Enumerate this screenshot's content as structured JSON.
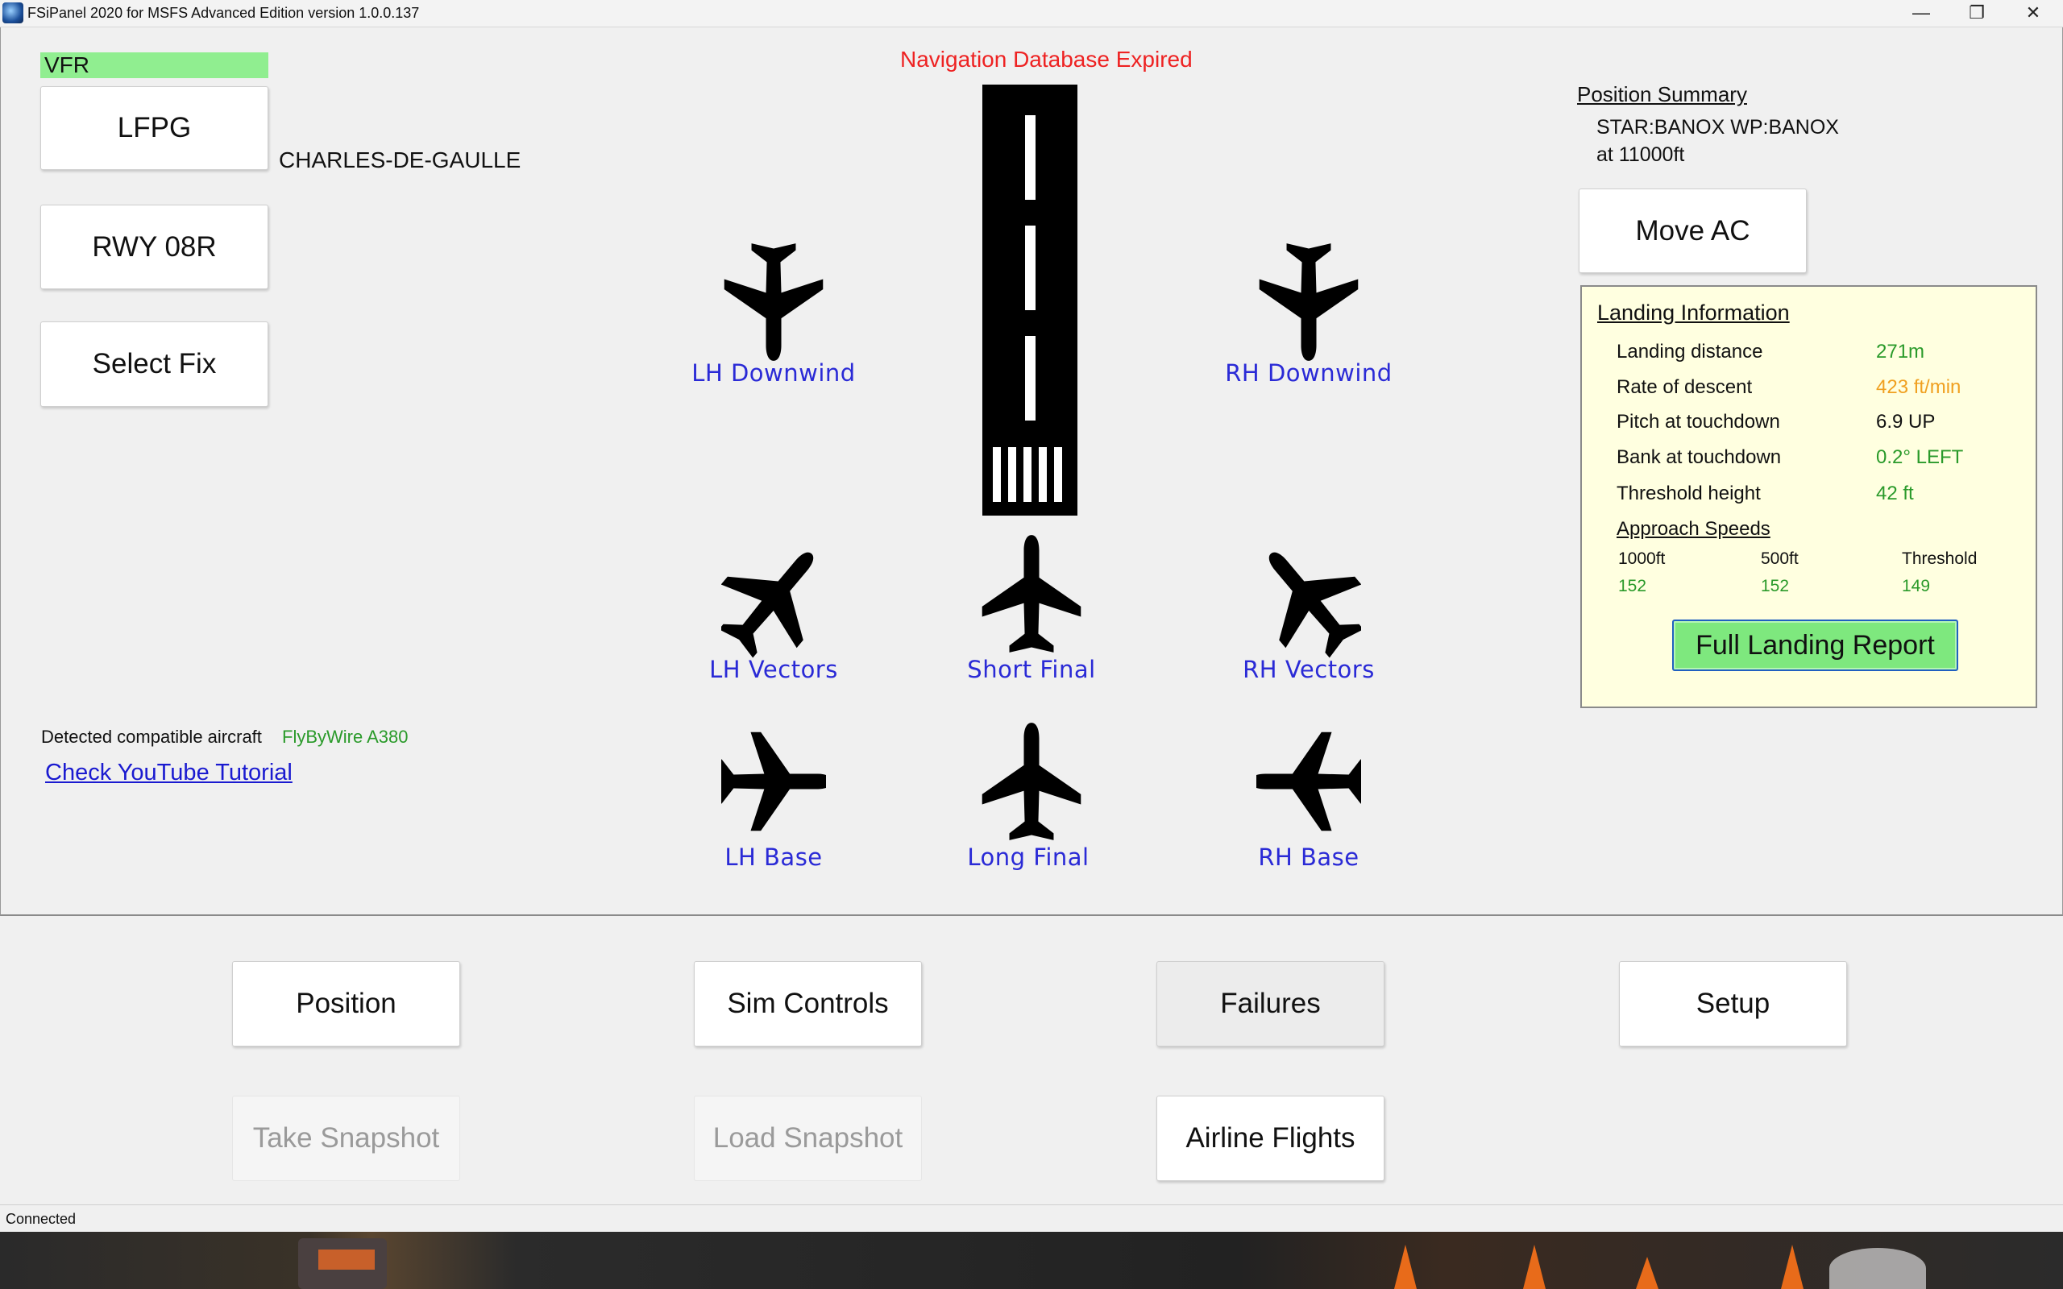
{
  "window": {
    "title": "FSiPanel 2020 for MSFS Advanced Edition version 1.0.0.137",
    "minimize_icon": "minimize-icon",
    "restore_icon": "restore-icon",
    "close_icon": "close-icon"
  },
  "flight_rules": "VFR",
  "airport": {
    "icao_button": "LFPG",
    "name": "CHARLES-DE-GAULLE",
    "runway_button": "RWY 08R",
    "select_fix_button": "Select Fix"
  },
  "nav_warning": "Navigation Database Expired",
  "patterns": {
    "lh_downwind": "LH Downwind",
    "rh_downwind": "RH Downwind",
    "lh_vectors": "LH Vectors",
    "short_final": "Short Final",
    "rh_vectors": "RH Vectors",
    "lh_base": "LH Base",
    "long_final": "Long Final",
    "rh_base": "RH Base"
  },
  "aircraft": {
    "label": "Detected compatible aircraft",
    "value": "FlyByWire A380",
    "tutorial_link": "Check YouTube Tutorial"
  },
  "position_summary": {
    "title": "Position Summary",
    "line1": "STAR:BANOX WP:BANOX",
    "line2": "at 11000ft",
    "move_button": "Move AC"
  },
  "landing_info": {
    "title": "Landing Information",
    "rows": [
      {
        "label": "Landing distance",
        "value": "271m",
        "color": "#2a9a2a"
      },
      {
        "label": "Rate of descent",
        "value": "423 ft/min",
        "color": "#f0a020"
      },
      {
        "label": "Pitch at touchdown",
        "value": "6.9 UP",
        "color": "#111111"
      },
      {
        "label": "Bank at touchdown",
        "value": "0.2° LEFT",
        "color": "#2a9a2a"
      },
      {
        "label": "Threshold height",
        "value": "42 ft",
        "color": "#2a9a2a"
      }
    ],
    "approach_speeds": {
      "title": "Approach Speeds",
      "headers": [
        "1000ft",
        "500ft",
        "Threshold"
      ],
      "values": [
        "152",
        "152",
        "149"
      ]
    },
    "report_button": "Full Landing Report"
  },
  "bottom_buttons": {
    "position": "Position",
    "sim_controls": "Sim Controls",
    "failures": "Failures",
    "setup": "Setup",
    "take_snapshot": "Take Snapshot",
    "load_snapshot": "Load Snapshot",
    "airline_flights": "Airline Flights"
  },
  "status": "Connected",
  "colors": {
    "vfr_bg": "#90ee90",
    "warning": "#ee2222",
    "pattern_label": "#2a2ad6",
    "good": "#2a9a2a",
    "caution": "#f0a020",
    "report_button_bg": "#7ee87e",
    "landing_box_bg": "#ffffe0"
  }
}
